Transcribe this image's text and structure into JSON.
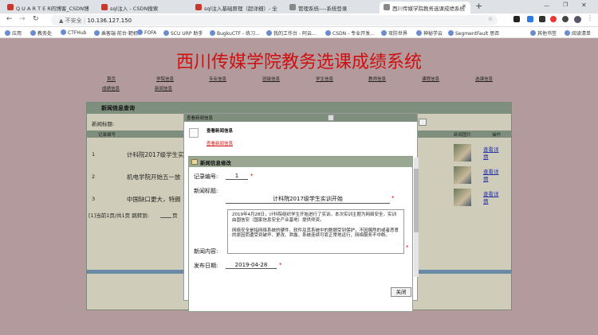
{
  "browser": {
    "tabs": [
      {
        "label": "Q U A R T E R的博客_CSDN博"
      },
      {
        "label": "sql注入 - CSDN搜索"
      },
      {
        "label": "sql注入基础原理（超详细）- 全"
      },
      {
        "label": "管理系统----系统登录"
      },
      {
        "label": "西川传媒学院教务选课成绩系统"
      }
    ],
    "insecure_label": "不安全",
    "url": "10.136.127.150",
    "bookmarks": [
      "应用",
      "教务处",
      "CTFHub",
      "乘客端·前台·靶机",
      "FOFA",
      "SCU URP 助手",
      "BugkuCTF - 练习...",
      "我的工作台 - 阿云...",
      "CSDN - 专业开发...",
      "攻防世界",
      "神秘学云",
      "SegmentFault 思否"
    ],
    "bookmarks_right": [
      "其他书签",
      "阅读清单"
    ]
  },
  "site": {
    "title": "西川传媒学院教务选课成绩系统",
    "nav": [
      "首页",
      "学院信息",
      "专业信息",
      "班级信息",
      "学生信息",
      "教师信息",
      "课程信息",
      "选课信息",
      "成绩信息",
      "新闻信息"
    ]
  },
  "main": {
    "header": "新闻信息查询",
    "search_label": "新闻标题:",
    "columns": [
      "记录编号",
      "新闻图片",
      "操作"
    ],
    "rows": [
      {
        "id": "1",
        "title": "计科院2017级学生实",
        "action": "查看详情"
      },
      {
        "id": "2",
        "title": "机电学院开始五一放",
        "action": "查看详情"
      },
      {
        "id": "3",
        "title": "中国缺口更大，特朗",
        "action": "查看详情"
      }
    ],
    "pager": "[1]当前1页/共1页 跳转到:",
    "pager_suffix": "页"
  },
  "modal_view": {
    "title": "查看新闻信息",
    "subtitle": "查看新闻信息",
    "link": "查看新闻信息"
  },
  "modal_edit": {
    "title": "新闻信息修改",
    "record_label": "记录编号:",
    "record_value": "1",
    "title_label": "新闻标题:",
    "title_value": "计科院2017级学生实训开始",
    "content_label": "新闻内容:",
    "content_value": "2019年4月28日，计科院组织学生开始进行了实训。本次实训主题为网络安全，实训由国信安（国家信息安全产业基地）提供师资。\n\n网络安全是指网络系统的硬件、软件及其系统中的数据受到保护，不因偶然的或者恶意的原因而遭受到破坏、更改、泄露，系统连续可靠正常地运行，网络服务不中断。",
    "date_label": "发布日期:",
    "date_value": "2019-04-28",
    "close_label": "关闭"
  }
}
